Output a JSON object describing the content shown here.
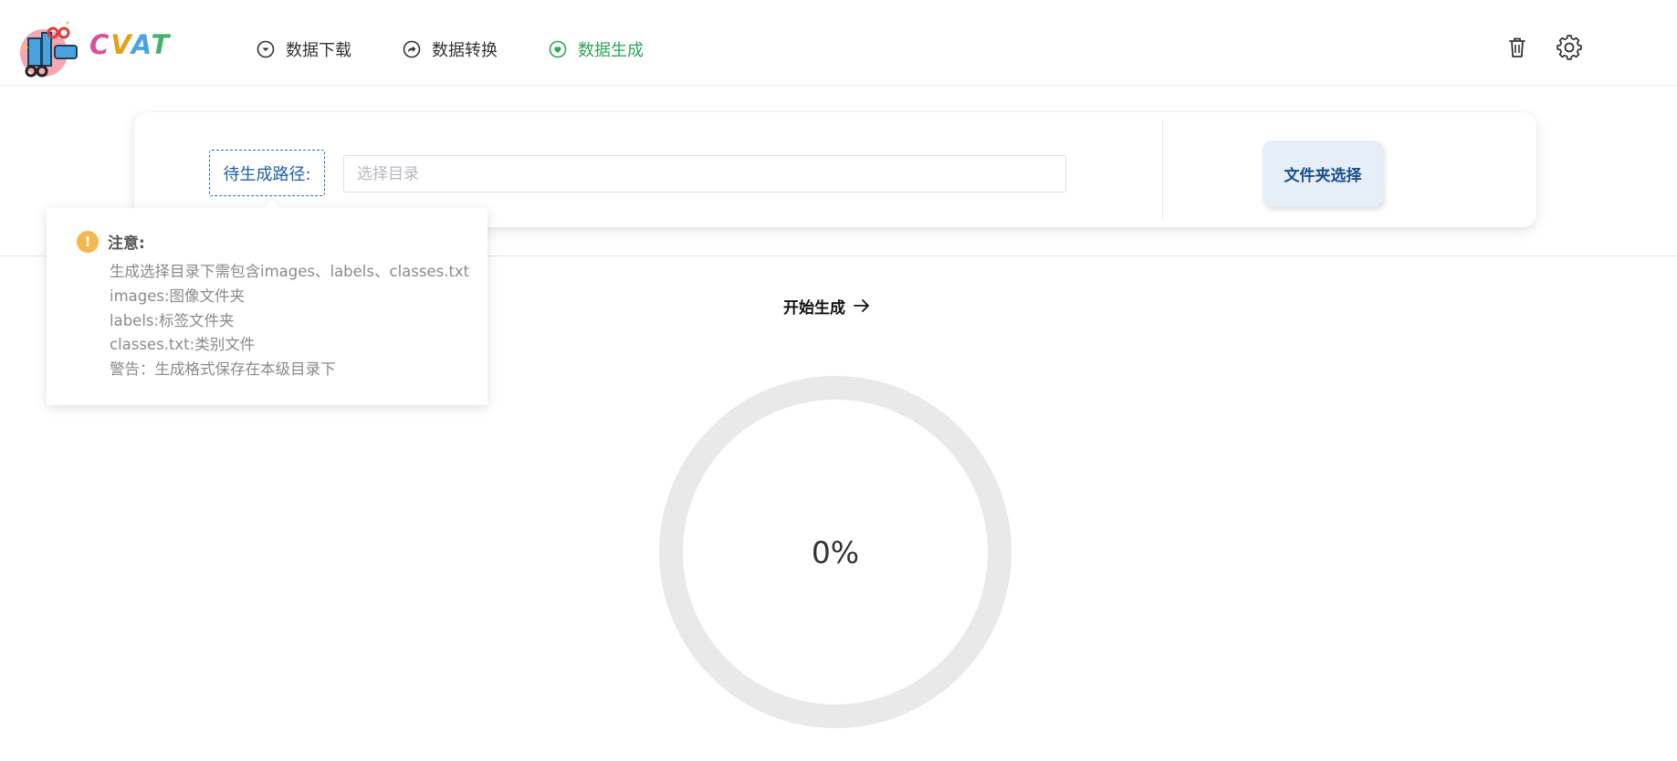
{
  "brand": {
    "logo_text": "CVAT"
  },
  "nav": {
    "items": [
      {
        "label": "数据下载",
        "icon": "download-circle-icon",
        "active": false
      },
      {
        "label": "数据转换",
        "icon": "share-arrow-circle-icon",
        "active": false
      },
      {
        "label": "数据生成",
        "icon": "heart-circle-icon",
        "active": true
      }
    ],
    "active_color": "#2ea35a"
  },
  "header_actions": {
    "delete_icon": "trash-icon",
    "settings_icon": "gear-icon"
  },
  "path_form": {
    "label": "待生成路径:",
    "placeholder": "选择目录",
    "value": "",
    "folder_button_label": "文件夹选择"
  },
  "tooltip": {
    "title": "注意:",
    "icon": "warning-icon",
    "lines": [
      "生成选择目录下需包含images、labels、classes.txt",
      "images:图像文件夹",
      "labels:标签文件夹",
      "classes.txt:类别文件",
      "警告：生成格式保存在本级目录下"
    ]
  },
  "start_button": {
    "label": "开始生成",
    "icon": "arrow-right-icon"
  },
  "progress": {
    "value": 0,
    "label": "0%"
  }
}
